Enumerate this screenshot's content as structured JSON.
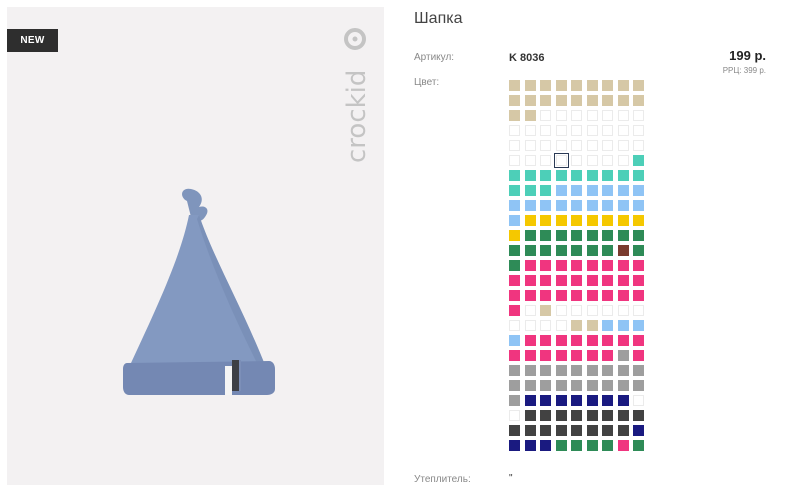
{
  "badge": "NEW",
  "brand": {
    "name": "crockid"
  },
  "product": {
    "title": "Шапка",
    "sku_label": "Артикул:",
    "sku": "K 8036",
    "price": "199 р.",
    "rrp": "РРЦ: 399 р.",
    "color_label": "Цвет:",
    "insulation_label": "Утеплитель:",
    "insulation_value": "\""
  },
  "swatches": {
    "selected_index": 48,
    "list": [
      "#d6c8a6",
      "#d6c8a6",
      "#d6c8a6",
      "#d6c8a6",
      "#d6c8a6",
      "#d6c8a6",
      "#d6c8a6",
      "#d6c8a6",
      "#d6c8a6",
      "#d6c8a6",
      "#d6c8a6",
      "#d6c8a6",
      "#d6c8a6",
      "#d6c8a6",
      "#d6c8a6",
      "#d6c8a6",
      "#d6c8a6",
      "#d6c8a6",
      "#d6c8a6",
      "#d6c8a6",
      "",
      "",
      "",
      "",
      "",
      "",
      "",
      "",
      "",
      "",
      "",
      "",
      "",
      "",
      "",
      "",
      "",
      "",
      "",
      "",
      "",
      "",
      "",
      "",
      "",
      "",
      "",
      "",
      "",
      "",
      "",
      "",
      "",
      "#4dcfb8",
      "#4dcfb8",
      "#4dcfb8",
      "#4dcfb8",
      "#4dcfb8",
      "#4dcfb8",
      "#4dcfb8",
      "#4dcfb8",
      "#4dcfb8",
      "#4dcfb8",
      "#4dcfb8",
      "#4dcfb8",
      "#4dcfb8",
      "#8fc4f5",
      "#8fc4f5",
      "#8fc4f5",
      "#8fc4f5",
      "#8fc4f5",
      "#8fc4f5",
      "#8fc4f5",
      "#8fc4f5",
      "#8fc4f5",
      "#8fc4f5",
      "#8fc4f5",
      "#8fc4f5",
      "#8fc4f5",
      "#8fc4f5",
      "#8fc4f5",
      "#8fc4f5",
      "#f5c800",
      "#f5c800",
      "#f5c800",
      "#f5c800",
      "#f5c800",
      "#f5c800",
      "#f5c800",
      "#f5c800",
      "#f5c800",
      "#2e8b57",
      "#2e8b57",
      "#2e8b57",
      "#2e8b57",
      "#2e8b57",
      "#2e8b57",
      "#2e8b57",
      "#2e8b57",
      "#2e8b57",
      "#2e8b57",
      "#2e8b57",
      "#2e8b57",
      "#2e8b57",
      "#2e8b57",
      "#2e8b57",
      "#7a3b2e",
      "#2e8b57",
      "#2e8b57",
      "#f0357f",
      "#f0357f",
      "#f0357f",
      "#f0357f",
      "#f0357f",
      "#f0357f",
      "#f0357f",
      "#f0357f",
      "#f0357f",
      "#f0357f",
      "#f0357f",
      "#f0357f",
      "#f0357f",
      "#f0357f",
      "#f0357f",
      "#f0357f",
      "#f0357f",
      "#f0357f",
      "#f0357f",
      "#f0357f",
      "#f0357f",
      "#f0357f",
      "#f0357f",
      "#f0357f",
      "#f0357f",
      "#f0357f",
      "#f0357f",
      "",
      "#d6c8a6",
      "",
      "",
      "",
      "",
      "",
      "",
      "",
      "",
      "",
      "",
      "#d6c8a6",
      "#d6c8a6",
      "#8fc4f5",
      "#8fc4f5",
      "#8fc4f5",
      "#8fc4f5",
      "#f0357f",
      "#f0357f",
      "#f0357f",
      "#f0357f",
      "#f0357f",
      "#f0357f",
      "#f0357f",
      "#f0357f",
      "#f0357f",
      "#f0357f",
      "#f0357f",
      "#f0357f",
      "#f0357f",
      "#f0357f",
      "#f0357f",
      "#9e9e9e",
      "#f0357f",
      "#9e9e9e",
      "#9e9e9e",
      "#9e9e9e",
      "#9e9e9e",
      "#9e9e9e",
      "#9e9e9e",
      "#9e9e9e",
      "#9e9e9e",
      "#9e9e9e",
      "#9e9e9e",
      "#9e9e9e",
      "#9e9e9e",
      "#9e9e9e",
      "#9e9e9e",
      "#9e9e9e",
      "#9e9e9e",
      "#9e9e9e",
      "#9e9e9e",
      "#9e9e9e",
      "#1a1a80",
      "#1a1a80",
      "#1a1a80",
      "#1a1a80",
      "#1a1a80",
      "#1a1a80",
      "#1a1a80",
      "",
      "",
      "#424242",
      "#424242",
      "#424242",
      "#424242",
      "#424242",
      "#424242",
      "#424242",
      "#424242",
      "#424242",
      "#424242",
      "#424242",
      "#424242",
      "#424242",
      "#424242",
      "#424242",
      "#424242",
      "#1a1a80",
      "#1a1a80",
      "#1a1a80",
      "#1a1a80",
      "#2e8b57",
      "#2e8b57",
      "#2e8b57",
      "#2e8b57",
      "#f0357f",
      "#2e8b57"
    ]
  }
}
